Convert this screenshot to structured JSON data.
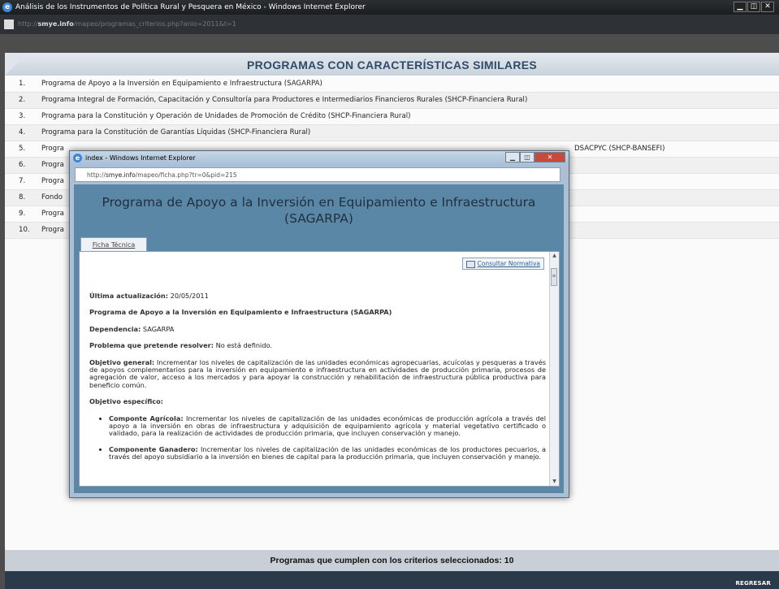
{
  "browser": {
    "title": "Análisis de los Instrumentos de Política Rural y Pesquera en México - Windows Internet Explorer",
    "url_prefix": "http://",
    "url_domain": "smye.info",
    "url_path": "/mapeo/programas_criterios.php?anio=2011&t=1",
    "controls": [
      "▁",
      "◫",
      "✕"
    ]
  },
  "main": {
    "heading": "PROGRAMAS CON CARACTERÍSTICAS SIMILARES",
    "programs": [
      {
        "num": "1.",
        "name": "Programa de Apoyo a la Inversión en Equipamiento e Infraestructura (SAGARPA)"
      },
      {
        "num": "2.",
        "name": "Programa Integral de Formación, Capacitación y Consultoría para Productores e Intermediarios Financieros Rurales (SHCP-Financiera Rural)"
      },
      {
        "num": "3.",
        "name": "Programa para la Constitución y Operación de Unidades de Promoción de Crédito (SHCP-Financiera Rural)"
      },
      {
        "num": "4.",
        "name": "Programa para la Constitución de Garantías Líquidas (SHCP-Financiera Rural)"
      },
      {
        "num": "5.",
        "name": "Progra",
        "tail": "DSACPYC (SHCP-BANSEFI)"
      },
      {
        "num": "6.",
        "name": "Progra"
      },
      {
        "num": "7.",
        "name": "Progra"
      },
      {
        "num": "8.",
        "name": "Fondo"
      },
      {
        "num": "9.",
        "name": "Progra"
      },
      {
        "num": "10.",
        "name": "Progra"
      }
    ],
    "footer_text": "Programas que cumplen con los criterios seleccionados: 10",
    "back_label": "REGRESAR"
  },
  "popup": {
    "title": "index - Windows Internet Explorer",
    "url_prefix": "http://",
    "url_domain": "smye.info",
    "url_path": "/mapeo/ficha.php?tr=0&pid=215",
    "controls": [
      "▁",
      "◫",
      "✕"
    ],
    "heading": "Programa de Apoyo a la Inversión en Equipamiento e Infraestructura (SAGARPA)",
    "tab_label": "Ficha Técnica",
    "consult_label": "Consultar Normativa",
    "updated_label": "Última actualización:",
    "updated_value": "20/05/2011",
    "program_name": "Programa de Apoyo a la Inversión en Equipamiento e Infraestructura (SAGARPA)",
    "dependencia_label": "Dependencia:",
    "dependencia_value": "SAGARPA",
    "problema_label": "Problema que pretende resolver:",
    "problema_value": "No está definido.",
    "objetivo_general_label": "Objetivo general:",
    "objetivo_general_value": "Incrementar los niveles de capitalización de las unidades económicas agropecuarias, acuícolas y pesqueras a través de apoyos complementarios para la inversión en equipamiento e infraestructura en actividades de producción primaria, procesos de agregación de valor, acceso a los mercados y para apoyar la construcción y rehabilitación de infraestructura pública productiva para beneficio común.",
    "objetivo_especifico_label": "Objetivo específico:",
    "componentes": [
      {
        "label": "Componte Agrícola:",
        "text": "Incrementar los niveles de capitalización de las unidades económicas de producción agrícola a través del apoyo a la inversión en obras de infraestructura y adquisición de equipamiento agrícola y material vegetativo certificado o validado, para la realización de actividades de producción primaria, que incluyen conservación y manejo."
      },
      {
        "label": "Componente Ganadero:",
        "text": "Incrementar los niveles de capitalización de las unidades económicas de los productores pecuarios, a través del apoyo subsidiario a la inversión en bienes de capital para la producción primaria, que incluyen conservación y manejo."
      }
    ]
  }
}
